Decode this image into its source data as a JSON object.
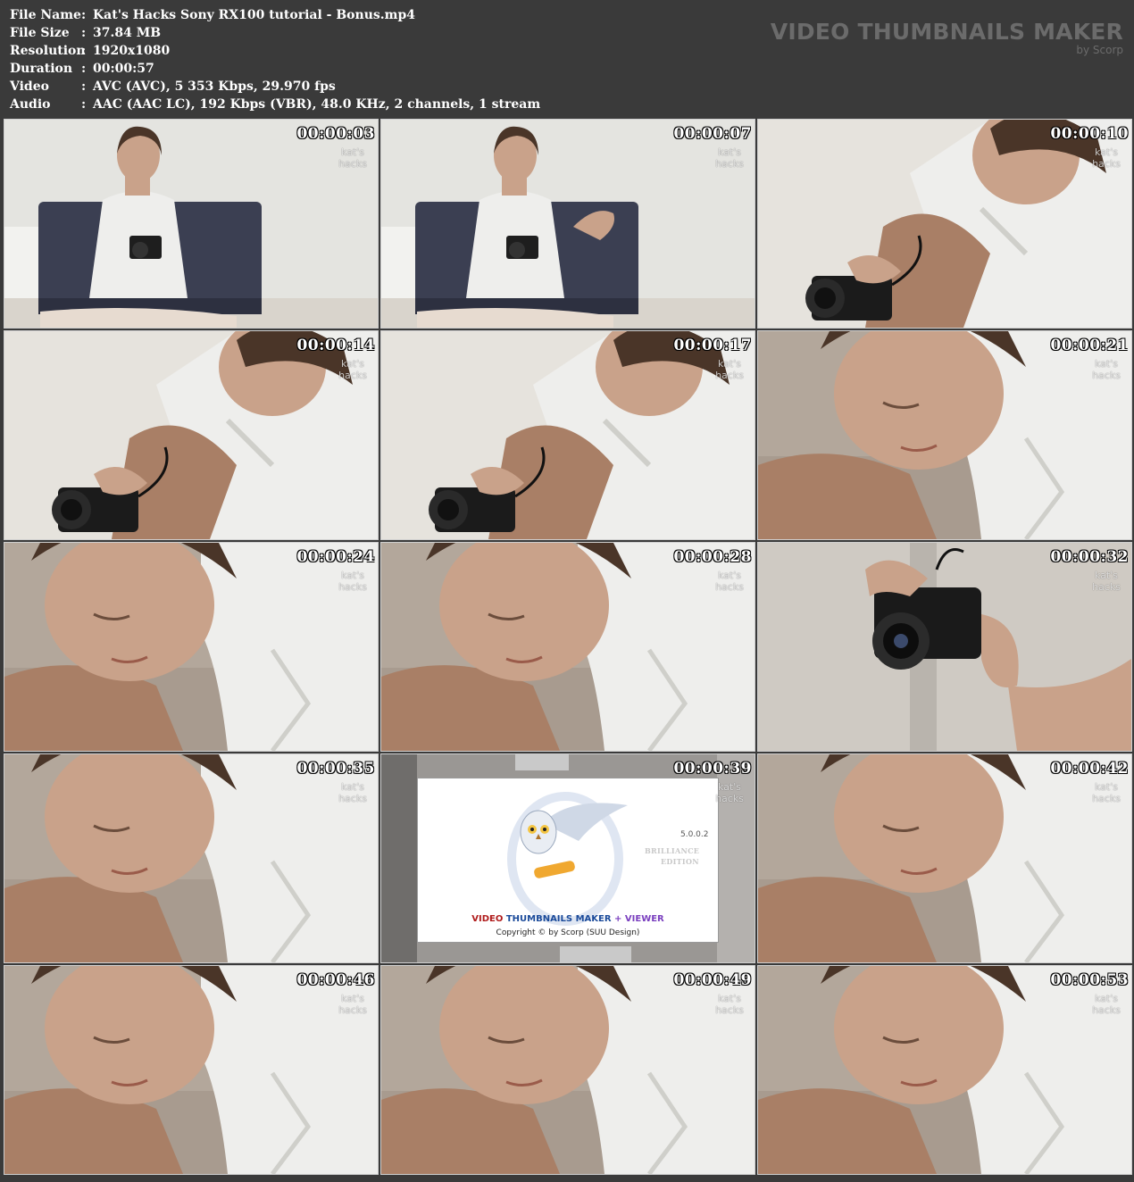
{
  "header": {
    "rows": [
      {
        "key": "File Name",
        "value": "Kat's Hacks Sony RX100 tutorial - Bonus.mp4"
      },
      {
        "key": "File Size",
        "value": "37.84 MB"
      },
      {
        "key": "Resolution",
        "value": "1920x1080"
      },
      {
        "key": "Duration",
        "value": "00:00:57"
      },
      {
        "key": "Video",
        "value": "AVC (AVC), 5 353 Kbps, 29.970 fps"
      },
      {
        "key": "Audio",
        "value": "AAC (AAC LC), 192 Kbps (VBR), 48.0 KHz, 2 channels, 1 stream"
      }
    ],
    "separator": ":",
    "brand": {
      "title": "VIDEO THUMBNAILS MAKER",
      "by": "by Scorp"
    }
  },
  "thumbnails": [
    {
      "time": "00:00:03",
      "scene": "sitting"
    },
    {
      "time": "00:00:07",
      "scene": "sitting-wave"
    },
    {
      "time": "00:00:10",
      "scene": "closeup-camera"
    },
    {
      "time": "00:00:14",
      "scene": "closeup-camera"
    },
    {
      "time": "00:00:17",
      "scene": "closeup-camera"
    },
    {
      "time": "00:00:21",
      "scene": "face-down"
    },
    {
      "time": "00:00:24",
      "scene": "face-down"
    },
    {
      "time": "00:00:28",
      "scene": "face-down"
    },
    {
      "time": "00:00:32",
      "scene": "hands-camera"
    },
    {
      "time": "00:00:35",
      "scene": "face-down"
    },
    {
      "time": "00:00:39",
      "scene": "splash"
    },
    {
      "time": "00:00:42",
      "scene": "face-down"
    },
    {
      "time": "00:00:46",
      "scene": "face-down"
    },
    {
      "time": "00:00:49",
      "scene": "face-down"
    },
    {
      "time": "00:00:53",
      "scene": "face-down"
    }
  ],
  "watermark": {
    "line1": "kat's",
    "line2": "hacks"
  },
  "splash": {
    "version": "5.0.0.2",
    "edition_line1": "BRILLIANCE",
    "edition_line2": "EDITION",
    "name_a": "VIDEO ",
    "name_b": "THUMBNAILS MAKER",
    "name_c": " + VIEWER",
    "copyright": "Copyright © by Scorp (SUU Design)"
  },
  "colors": {
    "background": "#3a3a3a",
    "text": "#ffffff",
    "brand": "#6b6b6b"
  }
}
